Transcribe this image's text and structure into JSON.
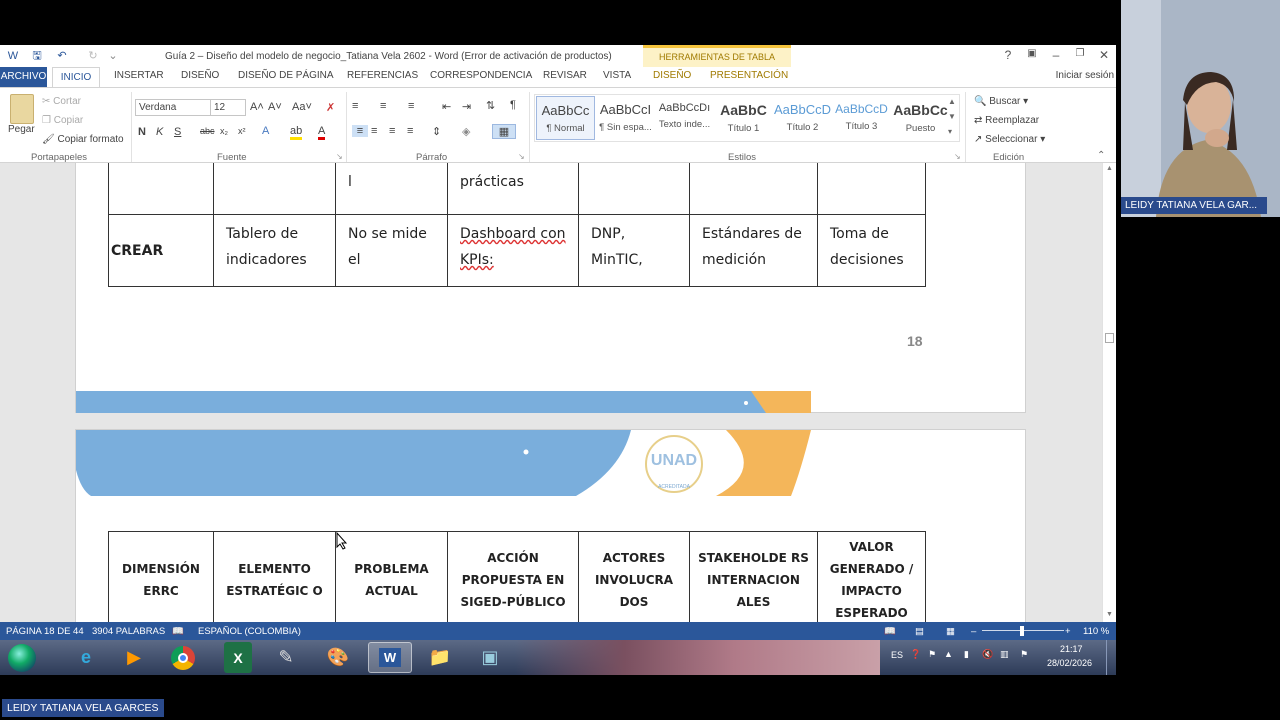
{
  "window": {
    "title": "Guía 2 – Diseño del modelo de negocio_Tatiana Vela 2602 - Word (Error de activación de productos)",
    "table_tools": "HERRAMIENTAS DE TABLA",
    "help": "?",
    "signin": "Iniciar sesión"
  },
  "tabs": [
    "ARCHIVO",
    "INICIO",
    "INSERTAR",
    "DISEÑO",
    "DISEÑO DE PÁGINA",
    "REFERENCIAS",
    "CORRESPONDENCIA",
    "REVISAR",
    "VISTA",
    "DISEÑO",
    "PRESENTACIÓN"
  ],
  "ribbon": {
    "clipboard": {
      "paste": "Pegar",
      "cut": "Cortar",
      "copy": "Copiar",
      "format_painter": "Copiar formato",
      "label": "Portapapeles"
    },
    "font": {
      "name": "Verdana",
      "size": "12",
      "label": "Fuente"
    },
    "paragraph": {
      "label": "Párrafo"
    },
    "styles": {
      "label": "Estilos",
      "items": [
        {
          "sample": "AaBbCc",
          "name": "¶ Normal"
        },
        {
          "sample": "AaBbCcI",
          "name": "¶ Sin espa..."
        },
        {
          "sample": "AaBbCcDı",
          "name": "Texto inde..."
        },
        {
          "sample": "AaBbC",
          "name": "Título 1"
        },
        {
          "sample": "AaBbCcD",
          "name": "Título 2"
        },
        {
          "sample": "AaBbCcD",
          "name": "Título 3"
        },
        {
          "sample": "AaBbCc",
          "name": "Puesto"
        }
      ]
    },
    "editing": {
      "find": "Buscar",
      "replace": "Reemplazar",
      "select": "Seleccionar",
      "label": "Edición"
    }
  },
  "document": {
    "table_top": {
      "row_partial": [
        "",
        "",
        "l",
        "prácticas",
        "",
        "",
        ""
      ],
      "row_crear": [
        "CREAR",
        "Tablero de indicadores",
        "No se mide el",
        "Dashboard con KPIs:",
        "DNP, MinTIC,",
        "Estándares de medición",
        "Toma de decisiones"
      ]
    },
    "page_number": "18",
    "table_headers": [
      "DIMENSIÓN ERRC",
      "ELEMENTO ESTRATÉGIC O",
      "PROBLEMA ACTUAL",
      "ACCIÓN PROPUESTA EN SIGED-PÚBLICO",
      "ACTORES INVOLUCRA DOS",
      "STAKEHOLDE RS INTERNACION ALES",
      "VALOR GENERADO / IMPACTO ESPERADO"
    ],
    "logo_text": "UNAD",
    "logo_subtext": "ACREDITADA"
  },
  "statusbar": {
    "page": "PÁGINA 18 DE 44",
    "words": "3904 PALABRAS",
    "language": "ESPAÑOL (COLOMBIA)",
    "zoom": "110 %"
  },
  "taskbar": {
    "lang": "ES",
    "time": "21:17",
    "date": "28/02/2026"
  },
  "participant_name": "LEIDY TATIANA VELA GAR...",
  "participant_name_full": "LEIDY TATIANA VELA GARCES",
  "colors": {
    "word_blue": "#2b579a",
    "band_blue": "#7aaedc",
    "band_orange": "#f4b65a"
  }
}
